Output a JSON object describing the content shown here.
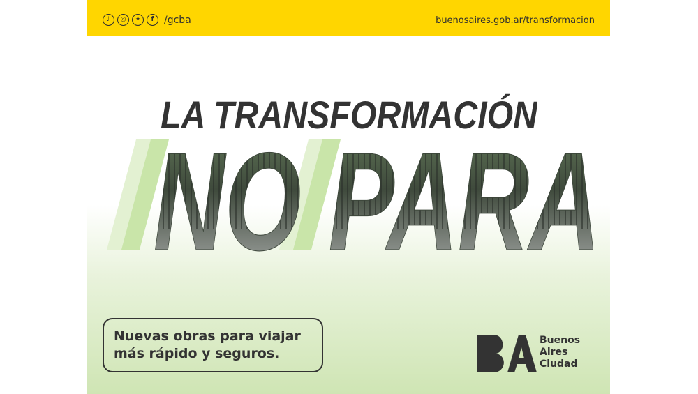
{
  "social": {
    "icons": [
      "tiktok-icon",
      "instagram-icon",
      "twitter-icon",
      "facebook-icon"
    ],
    "handle": "/gcba"
  },
  "header": {
    "url": "buenosaires.gob.ar/transformacion"
  },
  "headline": "LA TRANSFORMACIÓN",
  "big_word": "NO PARA",
  "tagline": {
    "line1": "Nuevas obras para viajar",
    "line2": "más rápido y seguros."
  },
  "logo": {
    "mark": "BA",
    "line1": "Buenos",
    "line2": "Aires",
    "line3": "Ciudad"
  },
  "colors": {
    "brand_yellow": "#ffd600",
    "text_dark": "#333333",
    "accent_green": "#b8dc8e"
  }
}
